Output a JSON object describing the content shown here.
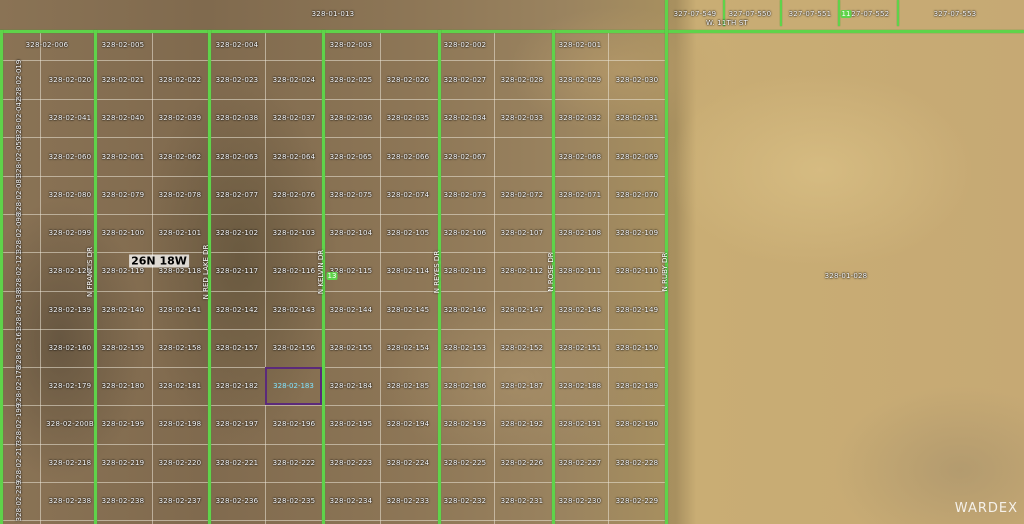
{
  "township": "26N 18W",
  "watermark": "WARDEX",
  "selected_parcel": "328-02-183",
  "north_parcel": "328-01-013",
  "east_parcel": "328-01-028",
  "top_right_parcels": [
    "327-07-549",
    "327-07-550",
    "327-07-551",
    "327-07-552",
    "327-07-553"
  ],
  "top_right_street": "W. 11TH ST",
  "route_markers": [
    "11",
    "13"
  ],
  "streets": [
    "N FRANCIS DR",
    "N RED LAKE DR",
    "N KELVIN DR",
    "N REYES DR",
    "N ROSE DR",
    "N RUBY DR"
  ],
  "west_column": [
    "328-02-019",
    "328-02-042",
    "328-02-059",
    "328-02-081",
    "328-02-098",
    "328-02-121",
    "328-02-138",
    "328-02-161",
    "328-02-178",
    "328-02-199",
    "328-02-217",
    "328-02-239"
  ],
  "rows": [
    [
      "328-02-006",
      "328-02-005",
      "328-02-004",
      "328-02-003",
      "328-02-002",
      "328-02-001"
    ],
    [
      "328-02-020",
      "328-02-021",
      "328-02-022",
      "328-02-023",
      "328-02-024",
      "328-02-025",
      "328-02-026",
      "328-02-027",
      "328-02-028",
      "328-02-029",
      "328-02-030"
    ],
    [
      "328-02-041",
      "328-02-040",
      "328-02-039",
      "328-02-038",
      "328-02-037",
      "328-02-036",
      "328-02-035",
      "328-02-034",
      "328-02-033",
      "328-02-032",
      "328-02-031"
    ],
    [
      "328-02-060",
      "328-02-061",
      "328-02-062",
      "328-02-063",
      "328-02-064",
      "328-02-065",
      "328-02-066",
      "328-02-067",
      "",
      "328-02-068",
      "328-02-069"
    ],
    [
      "328-02-080",
      "328-02-079",
      "328-02-078",
      "328-02-077",
      "328-02-076",
      "328-02-075",
      "328-02-074",
      "328-02-073",
      "328-02-072",
      "328-02-071",
      "328-02-070"
    ],
    [
      "328-02-099",
      "328-02-100",
      "328-02-101",
      "328-02-102",
      "328-02-103",
      "328-02-104",
      "328-02-105",
      "328-02-106",
      "328-02-107",
      "328-02-108",
      "328-02-109"
    ],
    [
      "328-02-120",
      "328-02-119",
      "328-02-118",
      "328-02-117",
      "328-02-116",
      "328-02-115",
      "328-02-114",
      "328-02-113",
      "328-02-112",
      "328-02-111",
      "328-02-110"
    ],
    [
      "328-02-139",
      "328-02-140",
      "328-02-141",
      "328-02-142",
      "328-02-143",
      "328-02-144",
      "328-02-145",
      "328-02-146",
      "328-02-147",
      "328-02-148",
      "328-02-149"
    ],
    [
      "328-02-160",
      "328-02-159",
      "328-02-158",
      "328-02-157",
      "328-02-156",
      "328-02-155",
      "328-02-154",
      "328-02-153",
      "328-02-152",
      "328-02-151",
      "328-02-150"
    ],
    [
      "328-02-179",
      "328-02-180",
      "328-02-181",
      "328-02-182",
      "",
      "328-02-184",
      "328-02-185",
      "328-02-186",
      "328-02-187",
      "328-02-188",
      "328-02-189"
    ],
    [
      "328-02-200B",
      "328-02-199",
      "328-02-198",
      "328-02-197",
      "328-02-196",
      "328-02-195",
      "328-02-194",
      "328-02-193",
      "328-02-192",
      "328-02-191",
      "328-02-190"
    ],
    [
      "328-02-218",
      "328-02-219",
      "328-02-220",
      "328-02-221",
      "328-02-222",
      "328-02-223",
      "328-02-224",
      "328-02-225",
      "328-02-226",
      "328-02-227",
      "328-02-228"
    ],
    [
      "328-02-238",
      "328-02-238",
      "328-02-237",
      "328-02-236",
      "328-02-235",
      "328-02-234",
      "328-02-233",
      "328-02-232",
      "328-02-231",
      "328-02-230",
      "328-02-229"
    ]
  ]
}
